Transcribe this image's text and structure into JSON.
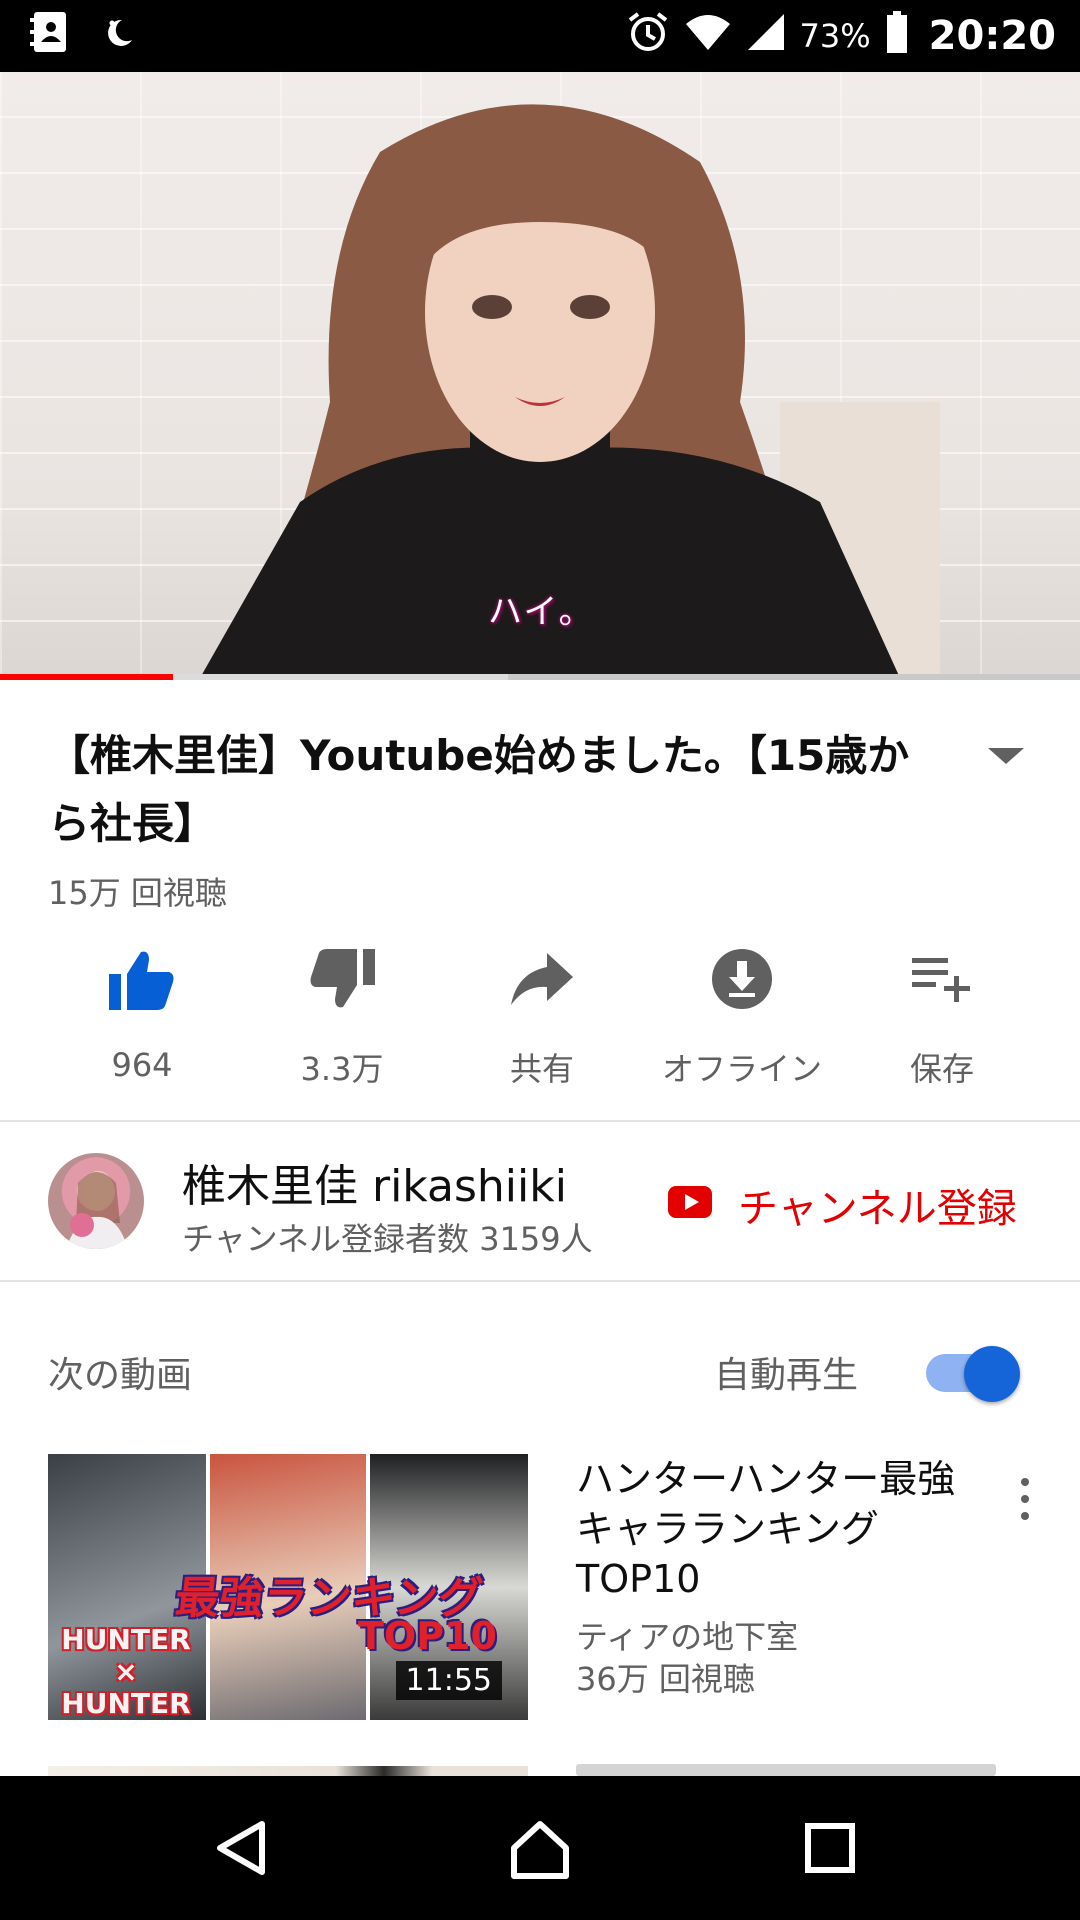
{
  "status_bar": {
    "battery_percent": "73%",
    "time": "20:20",
    "icons": [
      "contact-card-icon",
      "night-mode-icon",
      "alarm-icon",
      "wifi-icon",
      "signal-icon",
      "battery-icon"
    ]
  },
  "player": {
    "caption": "ハイ。",
    "progress_fraction": 0.16,
    "buffered_fraction": 0.47,
    "accent_color": "#ff0000"
  },
  "video": {
    "title": "【椎木里佳】Youtube始めました。【15歳から社長】",
    "views": "15万 回視聴"
  },
  "actions": [
    {
      "label": "964",
      "icon": "thumbs-up-icon"
    },
    {
      "label": "3.3万",
      "icon": "thumbs-down-icon"
    },
    {
      "label": "共有",
      "icon": "share-icon"
    },
    {
      "label": "オフライン",
      "icon": "download-icon"
    },
    {
      "label": "保存",
      "icon": "playlist-add-icon"
    }
  ],
  "channel": {
    "name": "椎木里佳 rikashiiki",
    "subscribers": "チャンネル登録者数 3159人",
    "subscribe_label": "チャンネル登録"
  },
  "up_next": {
    "heading": "次の動画",
    "autoplay_label": "自動再生",
    "autoplay_on": true,
    "items": [
      {
        "title": "ハンターハンター最強キャラランキングTOP10",
        "channel": "ティアの地下室",
        "views": "36万 回視聴",
        "duration": "11:55",
        "thumb_banner": "最強ランキング",
        "thumb_sub": "TOP10",
        "thumb_logo": "HUNTER × HUNTER"
      }
    ]
  },
  "nav": [
    "back-icon",
    "home-icon",
    "recents-icon"
  ]
}
